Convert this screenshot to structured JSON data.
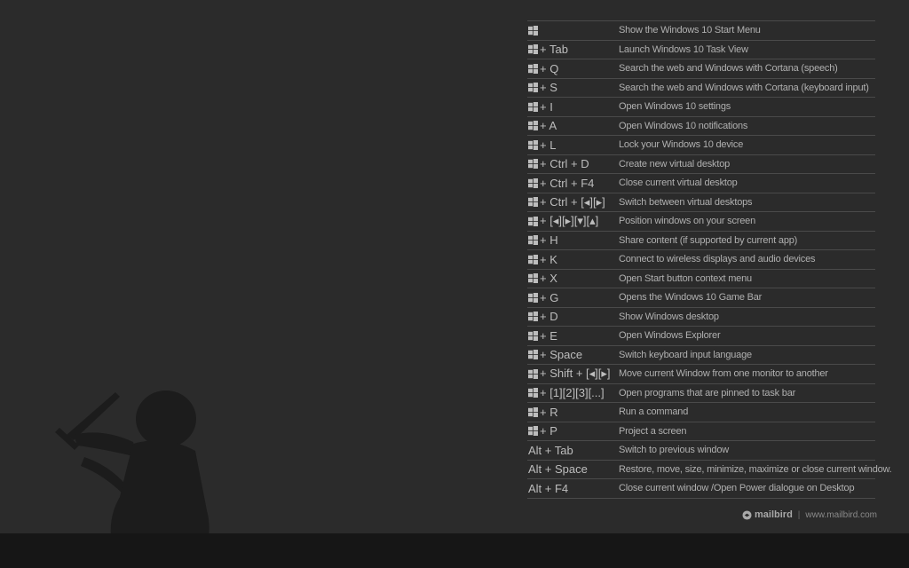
{
  "shortcuts": [
    {
      "win": true,
      "keys": "",
      "desc": "Show the Windows 10 Start Menu"
    },
    {
      "win": true,
      "keys": "+ Tab",
      "desc": "Launch Windows 10 Task View"
    },
    {
      "win": true,
      "keys": "+ Q",
      "desc": "Search the web and Windows with Cortana (speech)"
    },
    {
      "win": true,
      "keys": "+ S",
      "desc": "Search the web and Windows with Cortana (keyboard input)"
    },
    {
      "win": true,
      "keys": "+ I",
      "desc": "Open Windows 10 settings"
    },
    {
      "win": true,
      "keys": "+ A",
      "desc": "Open Windows 10 notifications"
    },
    {
      "win": true,
      "keys": "+ L",
      "desc": "Lock your Windows 10 device"
    },
    {
      "win": true,
      "keys": "+ Ctrl + D",
      "desc": "Create new virtual desktop"
    },
    {
      "win": true,
      "keys": "+ Ctrl + F4",
      "desc": "Close current virtual desktop"
    },
    {
      "win": true,
      "keys": "+ Ctrl + [◂][▸]",
      "desc": "Switch between virtual desktops"
    },
    {
      "win": true,
      "keys": "+ [◂][▸][▾][▴]",
      "desc": "Position windows on your screen"
    },
    {
      "win": true,
      "keys": "+ H",
      "desc": "Share content (if supported by current app)"
    },
    {
      "win": true,
      "keys": "+ K",
      "desc": "Connect to wireless displays and audio devices"
    },
    {
      "win": true,
      "keys": "+ X",
      "desc": "Open Start button context menu"
    },
    {
      "win": true,
      "keys": "+ G",
      "desc": "Opens the Windows 10 Game Bar"
    },
    {
      "win": true,
      "keys": "+ D",
      "desc": "Show Windows desktop"
    },
    {
      "win": true,
      "keys": "+ E",
      "desc": "Open Windows Explorer"
    },
    {
      "win": true,
      "keys": "+ Space",
      "desc": "Switch keyboard input language"
    },
    {
      "win": true,
      "keys": "+ Shift + [◂][▸]",
      "desc": "Move current Window from one monitor to another"
    },
    {
      "win": true,
      "keys": "+ [1][2][3][...]",
      "desc": "Open programs that are pinned to task bar"
    },
    {
      "win": true,
      "keys": "+ R",
      "desc": "Run a command"
    },
    {
      "win": true,
      "keys": "+ P",
      "desc": "Project a screen"
    },
    {
      "win": false,
      "keys": "Alt + Tab",
      "desc": "Switch to previous window"
    },
    {
      "win": false,
      "keys": "Alt + Space",
      "desc": "Restore, move, size, minimize, maximize or close current window."
    },
    {
      "win": false,
      "keys": "Alt + F4",
      "desc": "Close current window /Open Power dialogue on Desktop"
    }
  ],
  "branding": {
    "logo_text": "mailbird",
    "separator": "|",
    "url": "www.mailbird.com"
  },
  "icons": {
    "windows_key": "windows-logo-icon",
    "brand": "mailbird-logo-icon"
  },
  "colors": {
    "background": "#2b2b2b",
    "taskbar": "#161616",
    "text": "#b0b0b0",
    "divider": "#4a4a4a"
  }
}
